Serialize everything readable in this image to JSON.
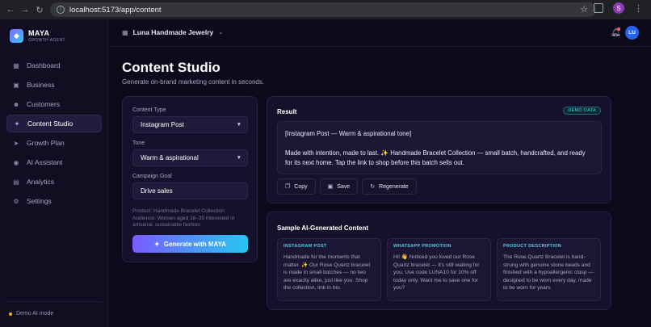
{
  "browser": {
    "url": "localhost:5173/app/content",
    "profile_initial": "S"
  },
  "brand": {
    "name": "MAYA",
    "subtitle": "GROWTH AGENT"
  },
  "sidebar": {
    "items": [
      {
        "label": "Dashboard",
        "icon": "grid-icon"
      },
      {
        "label": "Business",
        "icon": "briefcase-icon"
      },
      {
        "label": "Customers",
        "icon": "users-icon"
      },
      {
        "label": "Content Studio",
        "icon": "sparkle-icon",
        "active": true
      },
      {
        "label": "Growth Plan",
        "icon": "rocket-icon"
      },
      {
        "label": "AI Assistant",
        "icon": "bot-icon"
      },
      {
        "label": "Analytics",
        "icon": "chart-icon"
      },
      {
        "label": "Settings",
        "icon": "gear-icon"
      }
    ],
    "footer": "Demo AI mode"
  },
  "topbar": {
    "business_name": "Luna Handmade Jewelry",
    "avatar_initials": "LU"
  },
  "page": {
    "title": "Content Studio",
    "subtitle": "Generate on-brand marketing content in seconds."
  },
  "form": {
    "content_type_label": "Content Type",
    "content_type_value": "Instagram Post",
    "tone_label": "Tone",
    "tone_value": "Warm & aspirational",
    "goal_label": "Campaign Goal",
    "goal_value": "Drive sales",
    "product_line": "Product: Handmade Bracelet Collection",
    "audience_line": "Audience: Women aged 18–35 interested in artisanal, sustainable fashion",
    "generate_label": "Generate with MAYA"
  },
  "result": {
    "title": "Result",
    "badge": "DEMO DATA",
    "heading": "[Instagram Post — Warm & aspirational tone]",
    "body": "Made with intention, made to last. ✨ Handmade Bracelet Collection — small batch, handcrafted, and ready for its next home. Tap the link to shop before this batch sells out.",
    "copy_label": "Copy",
    "save_label": "Save",
    "regenerate_label": "Regenerate"
  },
  "samples": {
    "title": "Sample AI-Generated Content",
    "items": [
      {
        "tag": "INSTAGRAM POST",
        "text": "Handmade for the moments that matter. ✨ Our Rose Quartz bracelet is made in small batches — no two are exactly alike, just like you. Shop the collection, link in bio."
      },
      {
        "tag": "WHATSAPP PROMOTION",
        "text": "Hi! 👋 Noticed you loved our Rose Quartz bracelet — it's still waiting for you. Use code LUNA10 for 10% off today only. Want me to save one for you?"
      },
      {
        "tag": "PRODUCT DESCRIPTION",
        "text": "The Rose Quartz Bracelet is hand-strung with genuine stone beads and finished with a hypoallergenic clasp — designed to be worn every day, made to be worn for years."
      }
    ]
  },
  "colors": {
    "accent_start": "#7a5cff",
    "accent_end": "#27c6f0",
    "badge": "#4fd0e6",
    "notification": "#ff5c6c"
  }
}
